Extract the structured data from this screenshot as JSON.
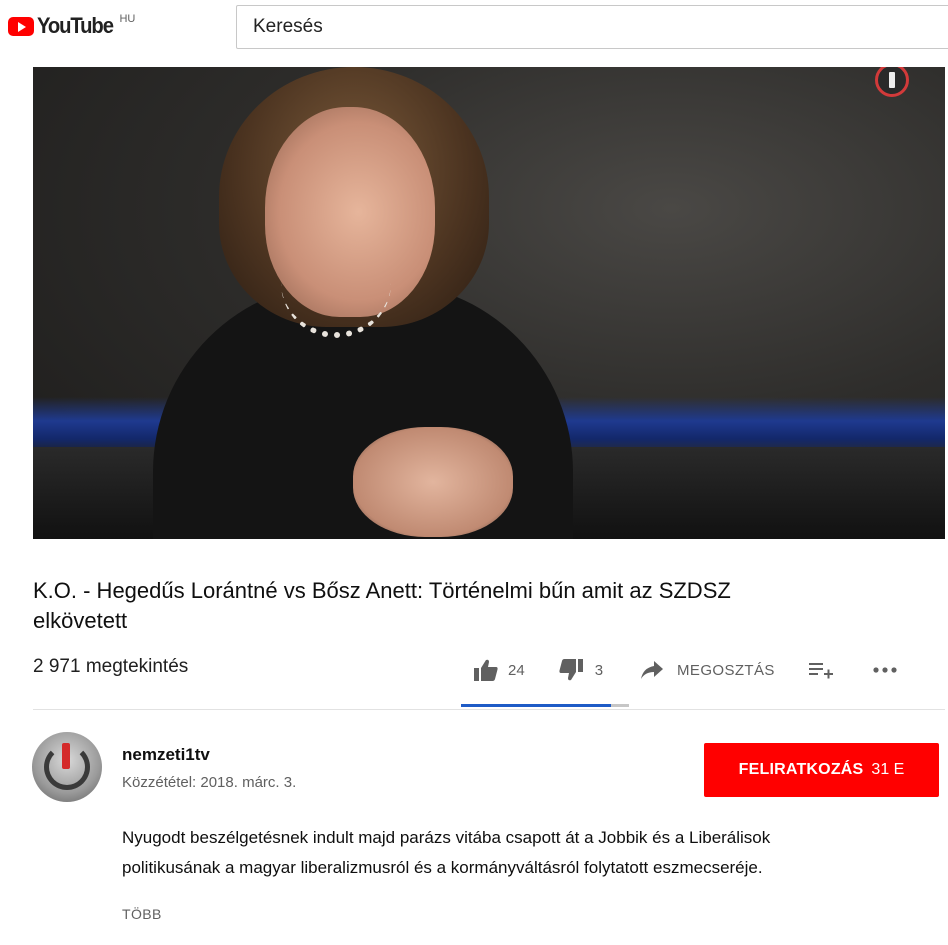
{
  "header": {
    "logo_text": "YouTube",
    "region": "HU",
    "search_placeholder": "Keresés"
  },
  "video": {
    "title_line1": "K.O. - Hegedűs Lorántné vs Bősz Anett: Történelmi bűn amit az SZDSZ",
    "title_line2": "elkövetett",
    "views": "2 971 megtekintés",
    "watermark_icon": "channel-logo-icon"
  },
  "actions": {
    "like_count": "24",
    "dislike_count": "3",
    "share_label": "MEGOSZTÁS",
    "like_ratio": 0.89
  },
  "channel": {
    "name": "nemzeti1tv",
    "published": "Közzététel: 2018. márc. 3.",
    "subscribe_label": "FELIRATKOZÁS",
    "subscriber_count": "31 E"
  },
  "description": {
    "line1": "Nyugodt beszélgetésnek indult majd parázs vitába csapott át a Jobbik és a Liberálisok",
    "line2": "politikusának a magyar liberalizmusról és a kormányváltásról folytatott eszmecseréje.",
    "more_label": "TÖBB"
  },
  "colors": {
    "brand_red": "#ff0000",
    "like_bar": "#1e5bc6",
    "muted_text": "#606060"
  }
}
